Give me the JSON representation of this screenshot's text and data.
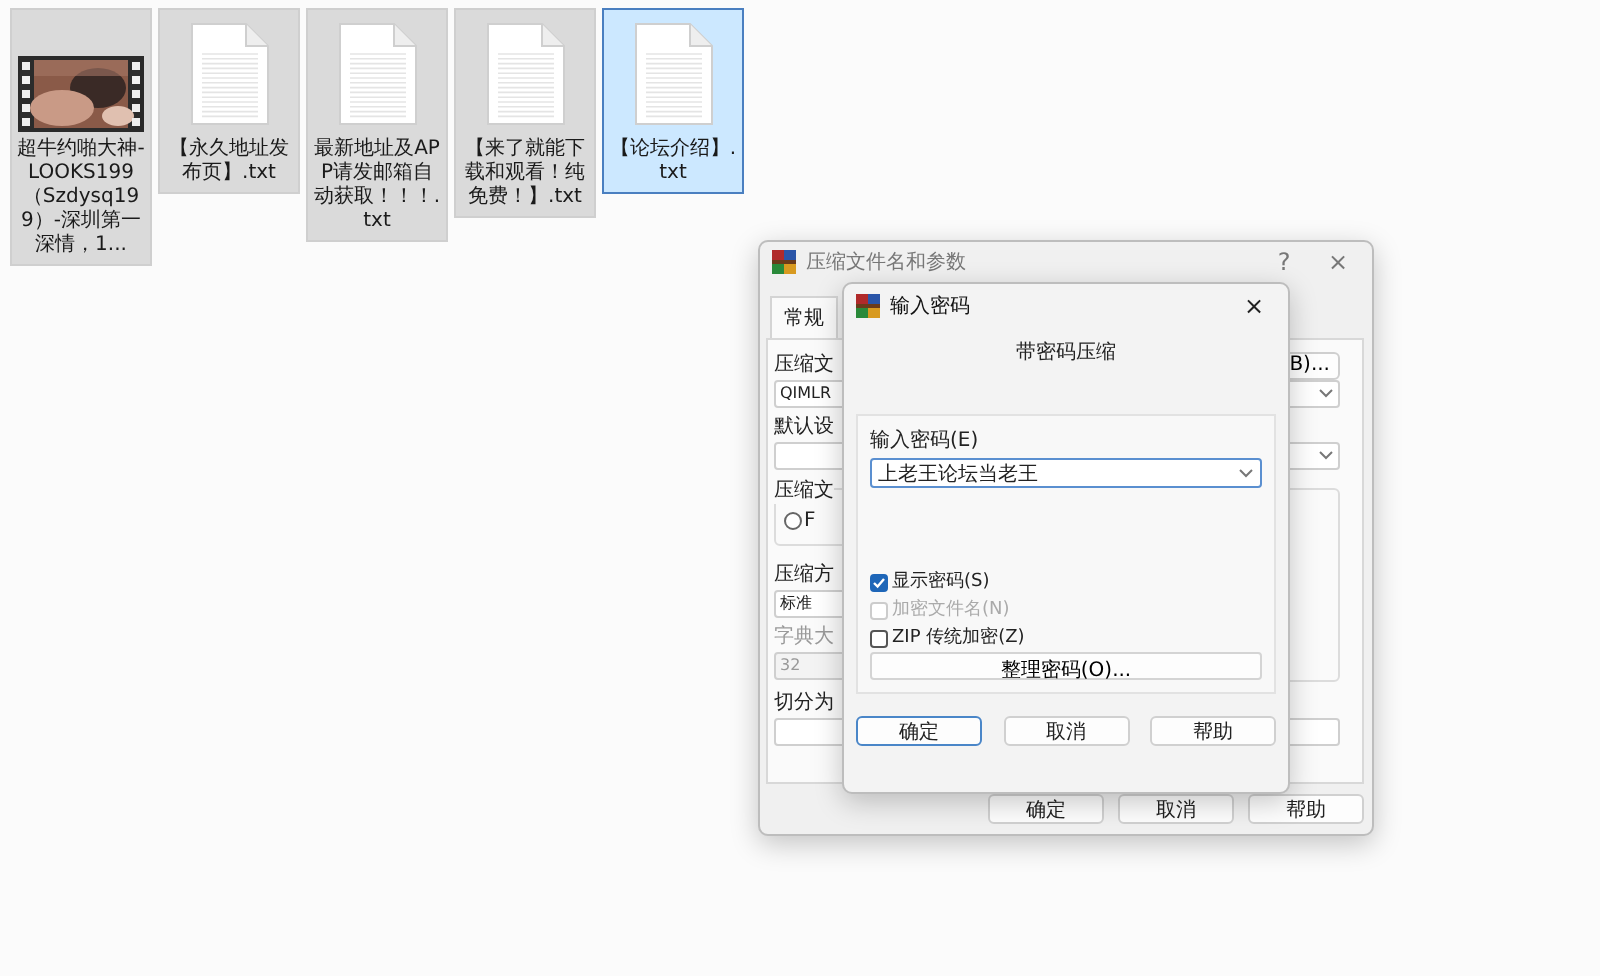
{
  "files": [
    {
      "kind": "video",
      "name": "超牛约啪大神-LOOKS199（Szdysq199）-深圳第一深情，1...",
      "selected": false
    },
    {
      "kind": "text",
      "name": "【永久地址发布页】.txt",
      "selected": false
    },
    {
      "kind": "text",
      "name": "最新地址及APP请发邮箱自动获取！！！.txt",
      "selected": false
    },
    {
      "kind": "text",
      "name": "【来了就能下载和观看！纯免费！】.txt",
      "selected": false
    },
    {
      "kind": "text",
      "name": "【论坛介绍】.txt",
      "selected": true
    }
  ],
  "archive_dialog": {
    "title": "压缩文件名和参数",
    "help": "?",
    "close": "×",
    "tabs": [
      {
        "label": "常规",
        "selected": true
      }
    ],
    "archive_label": "压缩文",
    "browse_button": "B)...",
    "archive_name": "QIMLR",
    "profile_label": "默认设",
    "format_group": "压缩文",
    "format_option": {
      "label": "F",
      "selected": false
    },
    "method_label": "压缩方",
    "method": "标准",
    "dict_label": "字典大",
    "dict_size": "32",
    "split_label": "切分为",
    "buttons": [
      "确定",
      "取消",
      "帮助"
    ]
  },
  "password_dialog": {
    "title": "输入密码",
    "close": "×",
    "heading": "带密码压缩",
    "password_label": "输入密码(E)",
    "password": "上老王论坛当老王",
    "options": [
      {
        "label": "显示密码(S)",
        "checked": true,
        "disabled": false
      },
      {
        "label": "加密文件名(N)",
        "checked": false,
        "disabled": true
      },
      {
        "label": "ZIP 传统加密(Z)",
        "checked": false,
        "disabled": false
      }
    ],
    "organize_button": "整理密码(O)...",
    "buttons": [
      {
        "label": "确定",
        "default": true
      },
      {
        "label": "取消",
        "default": false
      },
      {
        "label": "帮助",
        "default": false
      }
    ]
  }
}
